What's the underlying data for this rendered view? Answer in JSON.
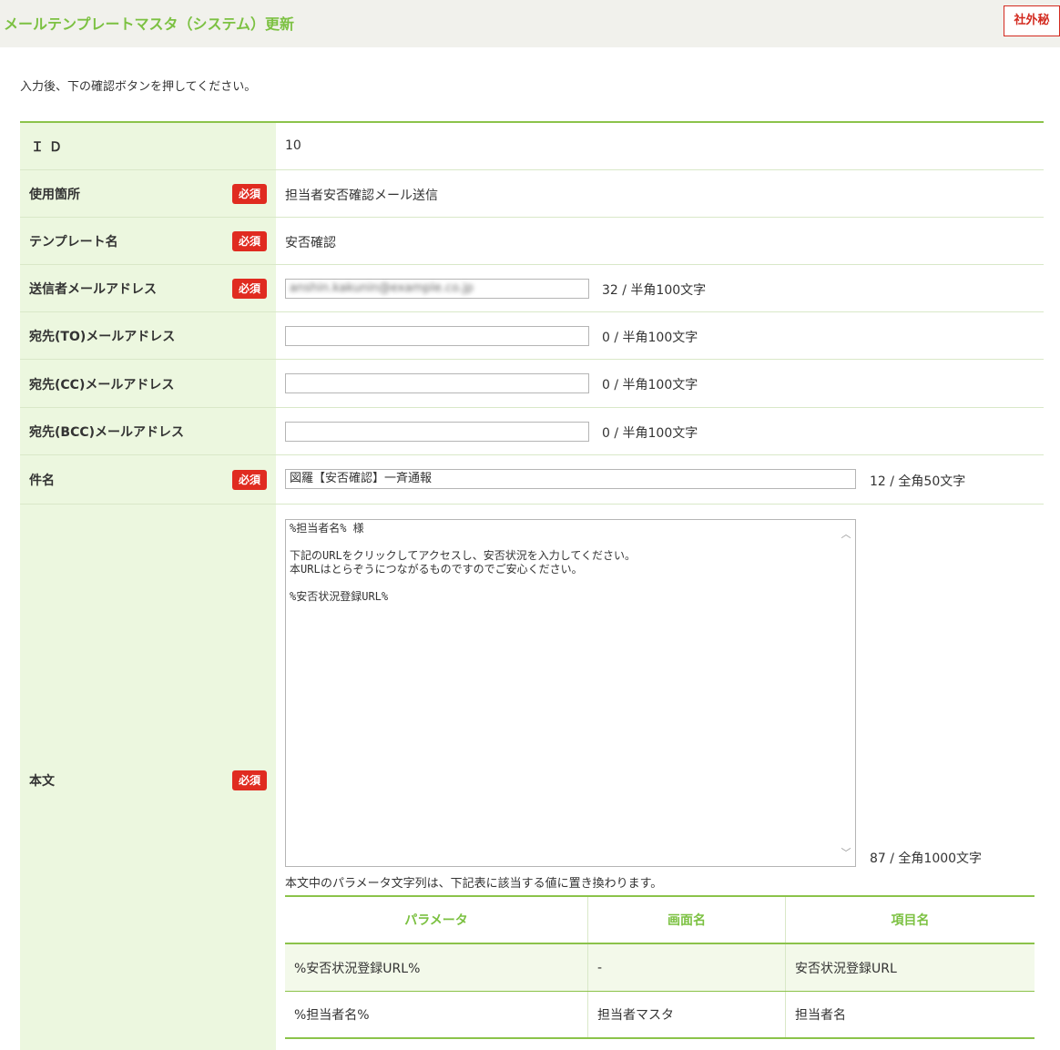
{
  "header": {
    "title": "メールテンプレートマスタ（システム）更新",
    "confidential_label": "社外秘"
  },
  "instruction": "入力後、下の確認ボタンを押してください。",
  "required_label": "必須",
  "fields": {
    "id": {
      "label": "ＩＤ",
      "value": "10"
    },
    "usage": {
      "label": "使用箇所",
      "value": "担当者安否確認メール送信"
    },
    "template_name": {
      "label": "テンプレート名",
      "value": "安否確認"
    },
    "sender": {
      "label": "送信者メールアドレス",
      "value": "anshin.kakunin@example.co.jp",
      "counter": "32 / 半角100文字"
    },
    "to": {
      "label": "宛先(TO)メールアドレス",
      "value": "",
      "counter": "0 / 半角100文字"
    },
    "cc": {
      "label": "宛先(CC)メールアドレス",
      "value": "",
      "counter": "0 / 半角100文字"
    },
    "bcc": {
      "label": "宛先(BCC)メールアドレス",
      "value": "",
      "counter": "0 / 半角100文字"
    },
    "subject": {
      "label": "件名",
      "value": "図羅【安否確認】一斉通報",
      "counter": "12 / 全角50文字"
    },
    "body": {
      "label": "本文",
      "lines": [
        "%担当者名% 様",
        "",
        "下記のURLをクリックしてアクセスし、安否状況を入力してください。",
        "本URLはとらぞうにつながるものですのでご安心ください。",
        "",
        "%安否状況登録URL%"
      ],
      "counter": "87 / 全角1000文字",
      "param_note": "本文中のパラメータ文字列は、下記表に該当する値に置き換わります。"
    }
  },
  "param_table": {
    "headers": [
      "パラメータ",
      "画面名",
      "項目名"
    ],
    "rows": [
      [
        "%安否状況登録URL%",
        "-",
        "安否状況登録URL"
      ],
      [
        "%担当者名%",
        "担当者マスタ",
        "担当者名"
      ]
    ]
  },
  "colors": {
    "accent_green": "#7cc142",
    "label_bg": "#ecf7df",
    "required_red": "#e02b20"
  }
}
